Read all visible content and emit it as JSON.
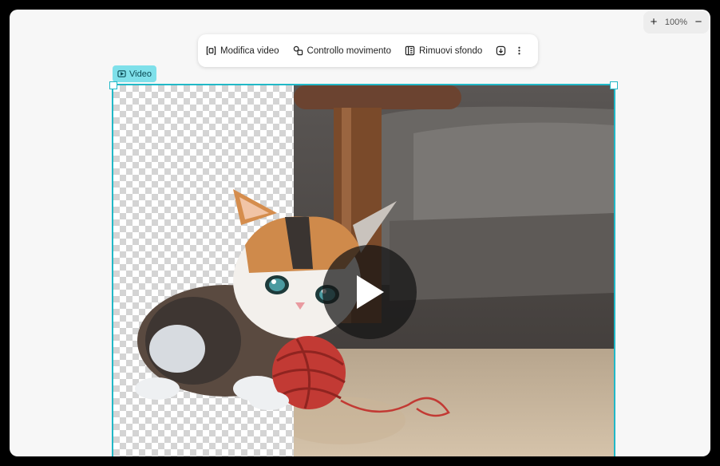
{
  "zoom": {
    "in_label": "+",
    "value": "100%",
    "out_label": "−"
  },
  "toolbar": {
    "edit_video": "Modifica video",
    "motion_control": "Controllo movimento",
    "remove_bg": "Rimuovi sfondo"
  },
  "element_tag": {
    "label": "Video"
  },
  "colors": {
    "selection": "#21b8c7",
    "tag_bg": "#7fe0ea"
  },
  "media": {
    "subject": "kitten playing with a red ball of yarn",
    "left_half": "background removed (transparent)",
    "right_half": "original background"
  }
}
